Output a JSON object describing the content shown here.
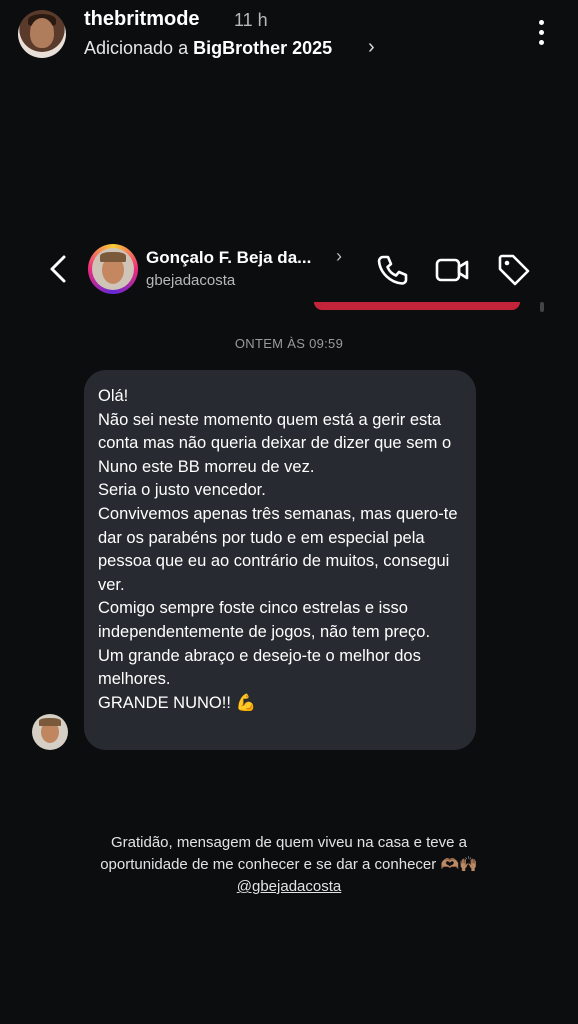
{
  "story": {
    "username": "thebritmode",
    "time": "11 h",
    "added_prefix": "Adicionado a ",
    "added_collection": "BigBrother 2025",
    "chevron": "›",
    "more_icon": "more-vertical-icon"
  },
  "dm": {
    "name": "Gonçalo F. Beja da...",
    "name_chevron": "›",
    "handle": "gbejadacosta",
    "icons": [
      "back-arrow-icon",
      "phone-icon",
      "video-camera-icon",
      "tag-icon"
    ],
    "accent_color": "#c4243a"
  },
  "conversation": {
    "timestamp": "ONTEM ÀS 09:59",
    "message": "Olá!\nNão sei neste momento quem está a gerir esta conta mas não queria deixar de dizer que sem o Nuno este BB morreu de vez.\nSeria o justo vencedor.\nConvivemos apenas três semanas, mas quero-te dar os parabéns por tudo e em especial pela pessoa que eu ao contrário de muitos, consegui ver.\nComigo sempre foste cinco estrelas e isso independentemente de jogos, não tem preço.\nUm grande abraço e desejo-te o melhor dos melhores.\nGRANDE NUNO!!",
    "message_emoji": "💪"
  },
  "caption": {
    "line1": "Gratidão, mensagem de quem viveu na casa e teve a",
    "line2": "oportunidade de me conhecer e se dar a conhecer",
    "line2_emoji": "🫶🏽🙌🏽",
    "mention": "@gbejadacosta"
  }
}
